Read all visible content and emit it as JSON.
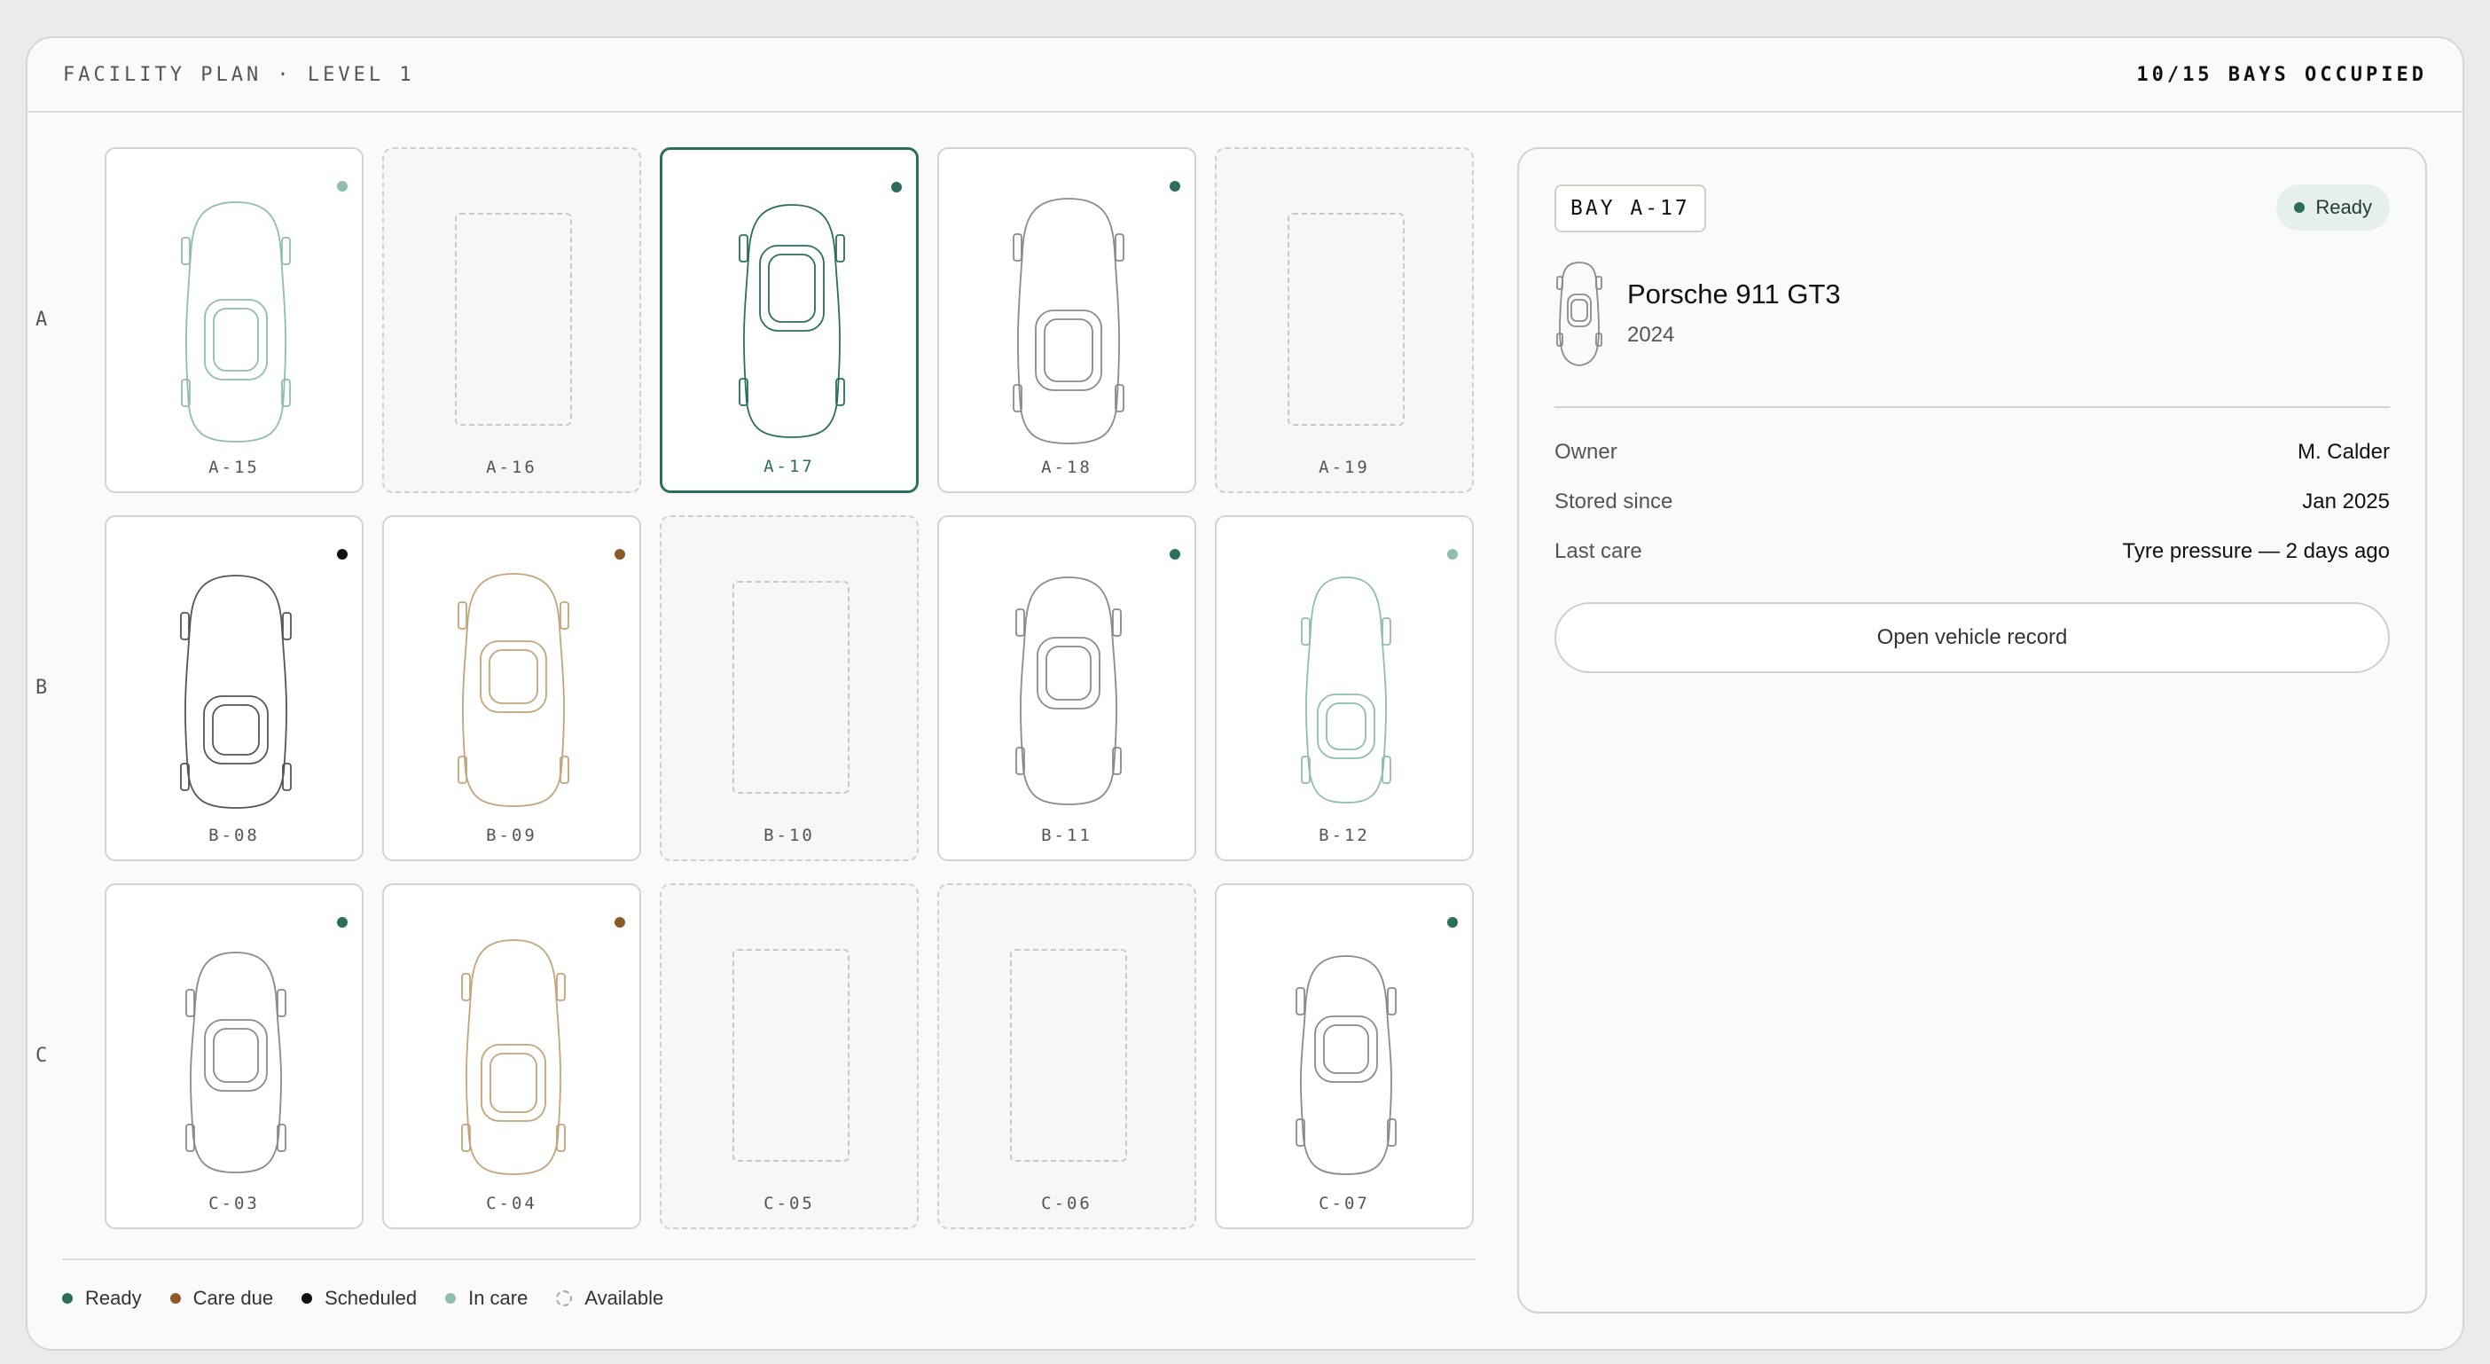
{
  "header": {
    "title": "FACILITY PLAN · LEVEL 1",
    "occupancy": "10/15 BAYS OCCUPIED"
  },
  "colors": {
    "ready": "#2b6e5c",
    "care_due": "#8a5a2b",
    "scheduled": "#111111",
    "in_care": "#8fbfa8",
    "car_green": "#2b6e5c",
    "car_mint": "#8fbfa8",
    "car_gray": "#8a8a88",
    "car_dark": "#555555",
    "car_tan": "#c4a47a"
  },
  "rows": [
    {
      "label": "A",
      "bays": [
        {
          "id": "A-15",
          "status": "in-care",
          "car": "mint",
          "shape": "a15"
        },
        {
          "id": "A-16",
          "status": "available"
        },
        {
          "id": "A-17",
          "status": "ready",
          "car": "green",
          "shape": "a17",
          "selected": true
        },
        {
          "id": "A-18",
          "status": "ready",
          "car": "gray",
          "shape": "a18"
        },
        {
          "id": "A-19",
          "status": "available"
        }
      ]
    },
    {
      "label": "B",
      "bays": [
        {
          "id": "B-08",
          "status": "scheduled",
          "car": "dark",
          "shape": "b08"
        },
        {
          "id": "B-09",
          "status": "care-due",
          "car": "tan",
          "shape": "b09"
        },
        {
          "id": "B-10",
          "status": "available"
        },
        {
          "id": "B-11",
          "status": "ready",
          "car": "gray",
          "shape": "b11"
        },
        {
          "id": "B-12",
          "status": "in-care",
          "car": "mint",
          "shape": "b12"
        }
      ]
    },
    {
      "label": "C",
      "bays": [
        {
          "id": "C-03",
          "status": "ready",
          "car": "gray",
          "shape": "c03"
        },
        {
          "id": "C-04",
          "status": "care-due",
          "car": "tan",
          "shape": "c04"
        },
        {
          "id": "C-05",
          "status": "available"
        },
        {
          "id": "C-06",
          "status": "available"
        },
        {
          "id": "C-07",
          "status": "ready",
          "car": "gray",
          "shape": "c07"
        }
      ]
    }
  ],
  "legend": [
    {
      "key": "ready",
      "label": "Ready"
    },
    {
      "key": "care-due",
      "label": "Care due"
    },
    {
      "key": "scheduled",
      "label": "Scheduled"
    },
    {
      "key": "in-care",
      "label": "In care"
    },
    {
      "key": "available",
      "label": "Available"
    }
  ],
  "detail": {
    "bay": "BAY A-17",
    "status": "Ready",
    "name": "Porsche 911 GT3",
    "year": "2024",
    "fields": [
      {
        "label": "Owner",
        "value": "M. Calder"
      },
      {
        "label": "Stored since",
        "value": "Jan 2025"
      },
      {
        "label": "Last care",
        "value": "Tyre pressure — 2 days ago"
      }
    ],
    "action_label": "Open vehicle record"
  }
}
